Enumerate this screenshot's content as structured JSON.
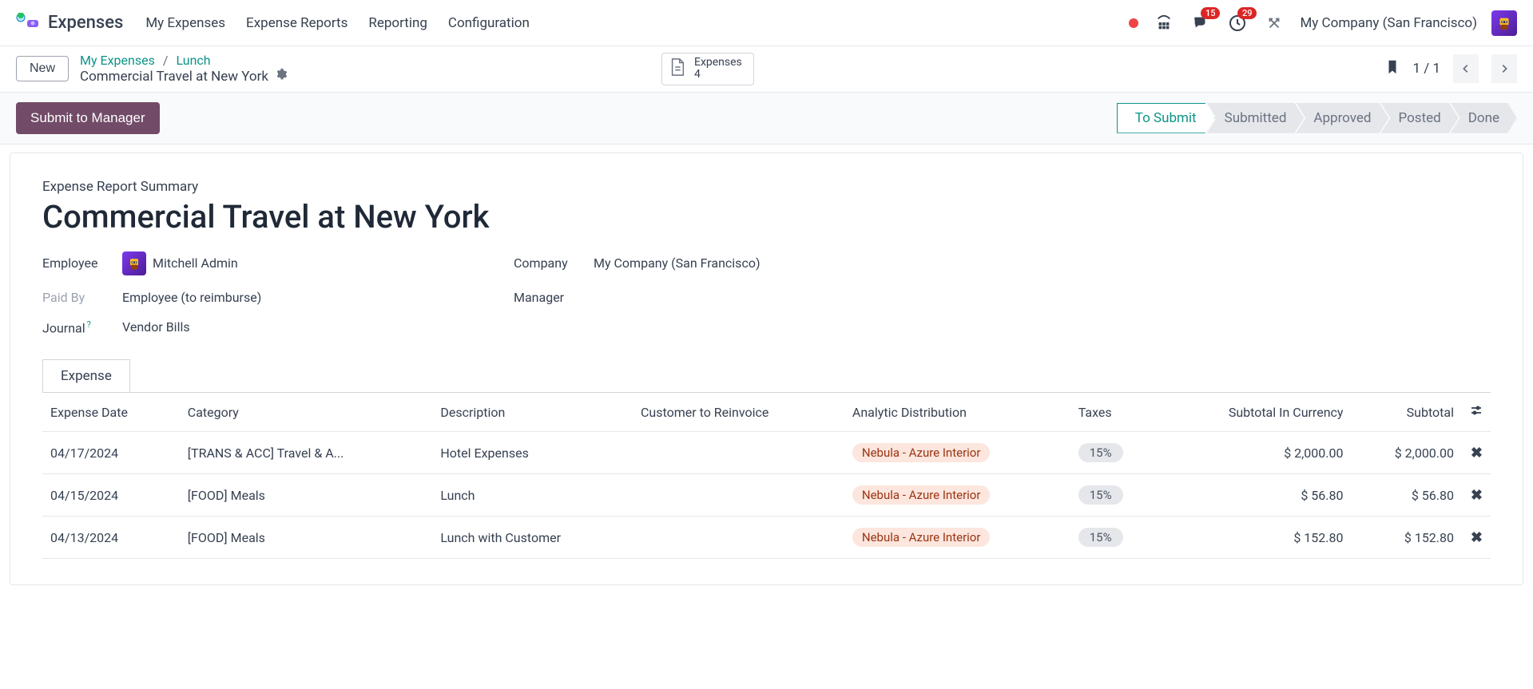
{
  "app": {
    "title": "Expenses"
  },
  "nav": {
    "items": [
      "My Expenses",
      "Expense Reports",
      "Reporting",
      "Configuration"
    ]
  },
  "topbar": {
    "messages_badge": "15",
    "activities_badge": "29",
    "company": "My Company (San Francisco)"
  },
  "subhead": {
    "new": "New",
    "breadcrumb": {
      "l1": "My Expenses",
      "l2": "Lunch"
    },
    "title": "Commercial Travel at New York",
    "expenses_card": {
      "label": "Expenses",
      "count": "4"
    },
    "pager": "1 / 1"
  },
  "actionbar": {
    "submit": "Submit to Manager",
    "statuses": [
      "To Submit",
      "Submitted",
      "Approved",
      "Posted",
      "Done"
    ]
  },
  "form": {
    "summary_label": "Expense Report Summary",
    "title": "Commercial Travel at New York",
    "employee_label": "Employee",
    "employee_value": "Mitchell Admin",
    "paid_by_label": "Paid By",
    "paid_by_value": "Employee (to reimburse)",
    "journal_label": "Journal",
    "journal_value": "Vendor Bills",
    "company_label": "Company",
    "company_value": "My Company (San Francisco)",
    "manager_label": "Manager",
    "help": "?"
  },
  "tabs": {
    "expense": "Expense"
  },
  "table": {
    "cols": {
      "date": "Expense Date",
      "category": "Category",
      "description": "Description",
      "customer": "Customer to Reinvoice",
      "analytic": "Analytic Distribution",
      "taxes": "Taxes",
      "subtotal_cur": "Subtotal In Currency",
      "subtotal": "Subtotal"
    },
    "rows": [
      {
        "date": "04/17/2024",
        "category": "[TRANS & ACC] Travel & A...",
        "description": "Hotel Expenses",
        "analytic": "Nebula - Azure Interior",
        "tax": "15%",
        "sub_cur": "$ 2,000.00",
        "sub": "$ 2,000.00"
      },
      {
        "date": "04/15/2024",
        "category": "[FOOD] Meals",
        "description": "Lunch",
        "analytic": "Nebula - Azure Interior",
        "tax": "15%",
        "sub_cur": "$ 56.80",
        "sub": "$ 56.80"
      },
      {
        "date": "04/13/2024",
        "category": "[FOOD] Meals",
        "description": "Lunch with Customer",
        "analytic": "Nebula - Azure Interior",
        "tax": "15%",
        "sub_cur": "$ 152.80",
        "sub": "$ 152.80"
      }
    ]
  }
}
